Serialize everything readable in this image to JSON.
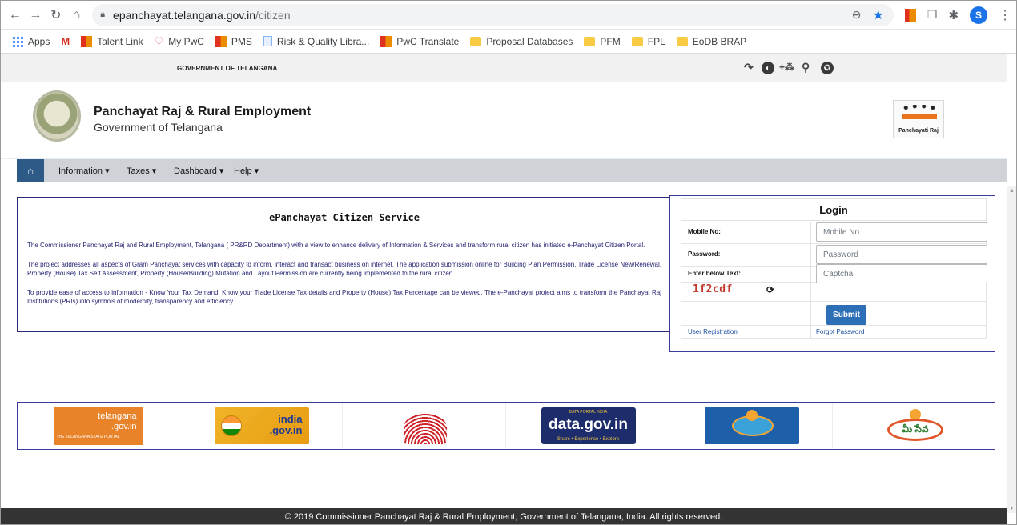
{
  "browser": {
    "url_host": "epanchayat.telangana.gov.in",
    "url_path": "/citizen",
    "profile_initial": "S",
    "bookmarks": [
      {
        "label": "Apps",
        "icon": "apps-grid-icon"
      },
      {
        "label": "",
        "icon": "gmail-icon"
      },
      {
        "label": "Talent Link",
        "icon": "pwc-icon"
      },
      {
        "label": "My PwC",
        "icon": "heart-icon"
      },
      {
        "label": "PMS",
        "icon": "pwc-icon"
      },
      {
        "label": "Risk & Quality Libra...",
        "icon": "document-icon"
      },
      {
        "label": "PwC Translate",
        "icon": "pwc-icon"
      },
      {
        "label": "Proposal Databases",
        "icon": "folder-icon"
      },
      {
        "label": "PFM",
        "icon": "folder-icon"
      },
      {
        "label": "FPL",
        "icon": "folder-icon"
      },
      {
        "label": "EoDB BRAP",
        "icon": "folder-icon"
      }
    ]
  },
  "site": {
    "gov_label": "GOVERNMENT OF TELANGANA",
    "title": "Panchayat Raj & Rural Employment",
    "subtitle": "Government of Telangana",
    "logo_text": "Panchayati Raj"
  },
  "menu": {
    "items": [
      "Information ▾",
      "Taxes ▾",
      "Dashboard ▾",
      "Help ▾"
    ]
  },
  "intro": {
    "heading": "ePanchayat Citizen Service",
    "paragraphs": [
      "The Commissioner Panchayat Raj and Rural Employment, Telangana ( PR&RD Department) with a view to enhance delivery of Information & Services and transform rural citizen has initiated e-Panchayat Citizen Portal.",
      "The project addresses all aspects of Gram Panchayat services with capacity to inform, interact and transact business on internet. The application submission online for Building Plan Permission, Trade License New/Renewal, Property (House) Tax Self Assessment, Property (House/Building) Mutation and Layout Permission are currently being implemented to the rural citizen.",
      "To provide ease of access to information - Know Your Tax Demand, Know your Trade License Tax details and Property (House) Tax Percentage can be viewed. The e-Panchayat project aims to transform the Panchayat Raj Institutions (PRIs) into symbols of modernity, transparency and efficiency."
    ]
  },
  "login": {
    "title": "Login",
    "mobile_label": "Mobile No:",
    "mobile_placeholder": "Mobile No",
    "password_label": "Password:",
    "password_placeholder": "Password",
    "captcha_label": "Enter below Text:",
    "captcha_placeholder": "Captcha",
    "captcha_text": "1f2cdf",
    "submit_label": "Submit",
    "register_link": "User Registration",
    "forgot_link": "Forgot Password"
  },
  "banners": {
    "telangana_line1": "telangana",
    "telangana_line2": ".gov.in",
    "telangana_sub": "THE TELANGANA STATE PORTAL",
    "india_line1": "india",
    "india_line2": ".gov.in",
    "datagov_top": "DATA PORTAL INDIA",
    "datagov_main": "data.gov.in",
    "datagov_bottom": "Share • Experience • Explore",
    "meeseva2_text": "మీ సేవ"
  },
  "footer": {
    "text": "© 2019 Commissioner Panchayat Raj & Rural Employment, Government of Telangana, India. All rights reserved."
  }
}
